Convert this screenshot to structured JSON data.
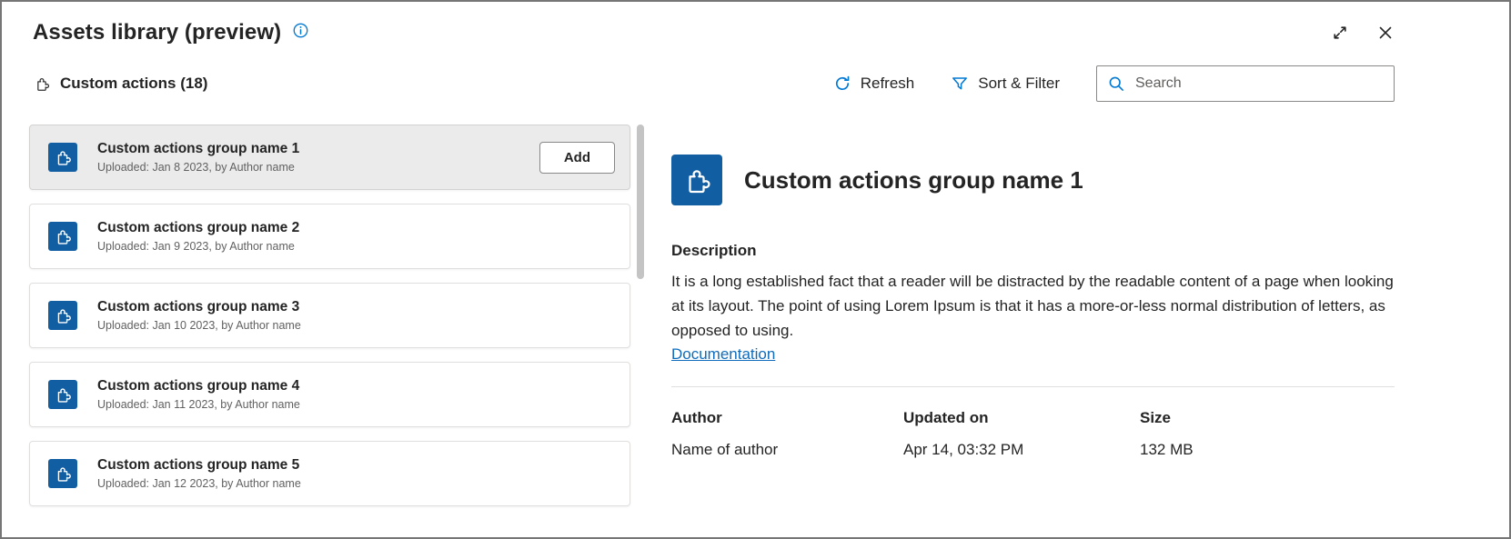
{
  "window": {
    "title": "Assets library (preview)"
  },
  "toolbar": {
    "section_title": "Custom actions (18)",
    "refresh_label": "Refresh",
    "sort_filter_label": "Sort & Filter",
    "search_placeholder": "Search"
  },
  "list": {
    "add_label": "Add",
    "items": [
      {
        "title": "Custom actions group name 1",
        "subtitle": "Uploaded: Jan 8 2023, by Author name",
        "selected": true
      },
      {
        "title": "Custom actions group name 2",
        "subtitle": "Uploaded: Jan 9 2023, by Author name",
        "selected": false
      },
      {
        "title": "Custom actions group name 3",
        "subtitle": "Uploaded: Jan 10 2023, by Author name",
        "selected": false
      },
      {
        "title": "Custom actions group name 4",
        "subtitle": "Uploaded: Jan 11 2023, by Author name",
        "selected": false
      },
      {
        "title": "Custom actions group name 5",
        "subtitle": "Uploaded: Jan 12 2023, by Author name",
        "selected": false
      }
    ]
  },
  "details": {
    "title": "Custom actions group name 1",
    "description_heading": "Description",
    "description_text": "It is a long established fact that a reader will be distracted by the readable content of a page when looking at its layout. The point of using Lorem Ipsum is that it has a more-or-less normal distribution of letters, as opposed to using.",
    "documentation_label": "Documentation",
    "meta": {
      "author_label": "Author",
      "author_value": "Name of author",
      "updated_label": "Updated on",
      "updated_value": "Apr 14, 03:32 PM",
      "size_label": "Size",
      "size_value": "132 MB"
    }
  },
  "icons": {
    "title_info": "info-icon",
    "window_expand": "expand-icon",
    "window_close": "close-icon",
    "section": "custom-actions-icon",
    "refresh": "refresh-icon",
    "sort_filter": "filter-icon",
    "search": "search-icon",
    "list_item": "custom-actions-icon",
    "details_header": "custom-actions-icon"
  },
  "colors": {
    "accent": "#0078d4",
    "icon_blue": "#115ea3",
    "link": "#0f6cbd",
    "selected_bg": "#ebebeb"
  }
}
